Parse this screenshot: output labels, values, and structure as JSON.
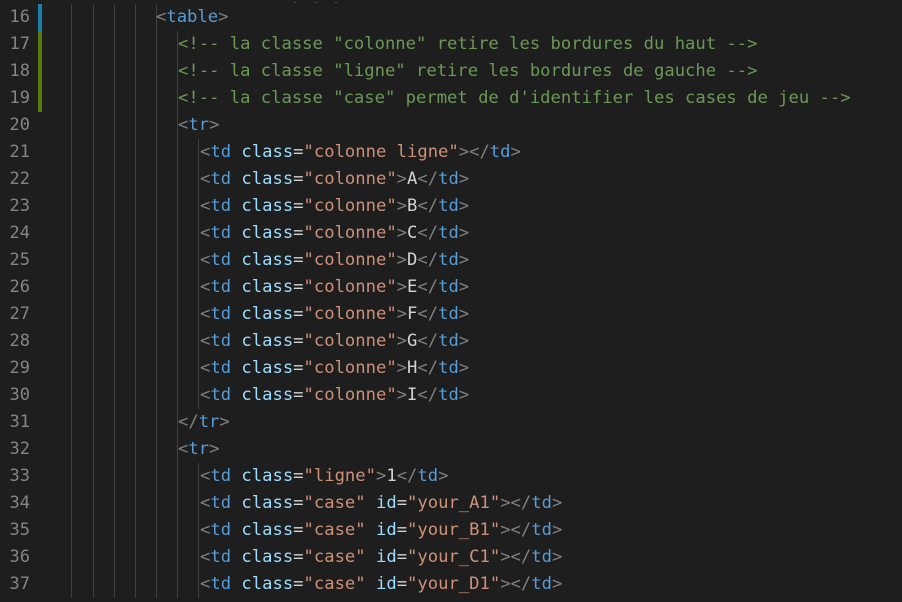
{
  "editor": {
    "theme": {
      "background": "#1e1e1e",
      "added_marker": "#587c0c",
      "modified_marker": "#1b81a8"
    },
    "lines": [
      {
        "n": "16",
        "marker": "modified",
        "tokens": [
          {
            "t": "punct",
            "v": "<"
          },
          {
            "t": "tag",
            "v": "table"
          },
          {
            "t": "punct",
            "v": ">"
          }
        ]
      },
      {
        "n": "17",
        "marker": "added",
        "tokens": [
          {
            "t": "comment",
            "v": "<!-- la classe \"colonne\" retire les bordures du haut -->"
          }
        ]
      },
      {
        "n": "18",
        "marker": "added",
        "tokens": [
          {
            "t": "comment",
            "v": "<!-- la classe \"ligne\" retire les bordures de gauche -->"
          }
        ]
      },
      {
        "n": "19",
        "marker": "added",
        "tokens": [
          {
            "t": "comment",
            "v": "<!-- la classe \"case\" permet de d'identifier les cases de jeu -->"
          }
        ]
      },
      {
        "n": "20",
        "marker": "",
        "tokens": [
          {
            "t": "punct",
            "v": "<"
          },
          {
            "t": "tag",
            "v": "tr"
          },
          {
            "t": "punct",
            "v": ">"
          }
        ]
      },
      {
        "n": "21",
        "marker": "",
        "tokens": [
          {
            "t": "punct",
            "v": "<"
          },
          {
            "t": "tag",
            "v": "td"
          },
          {
            "t": "text",
            "v": " "
          },
          {
            "t": "attr",
            "v": "class"
          },
          {
            "t": "text",
            "v": "="
          },
          {
            "t": "str",
            "v": "\"colonne ligne\""
          },
          {
            "t": "punct",
            "v": "></"
          },
          {
            "t": "tag",
            "v": "td"
          },
          {
            "t": "punct",
            "v": ">"
          }
        ]
      },
      {
        "n": "22",
        "marker": "",
        "tokens": [
          {
            "t": "punct",
            "v": "<"
          },
          {
            "t": "tag",
            "v": "td"
          },
          {
            "t": "text",
            "v": " "
          },
          {
            "t": "attr",
            "v": "class"
          },
          {
            "t": "text",
            "v": "="
          },
          {
            "t": "str",
            "v": "\"colonne\""
          },
          {
            "t": "punct",
            "v": ">"
          },
          {
            "t": "text",
            "v": "A"
          },
          {
            "t": "punct",
            "v": "</"
          },
          {
            "t": "tag",
            "v": "td"
          },
          {
            "t": "punct",
            "v": ">"
          }
        ]
      },
      {
        "n": "23",
        "marker": "",
        "tokens": [
          {
            "t": "punct",
            "v": "<"
          },
          {
            "t": "tag",
            "v": "td"
          },
          {
            "t": "text",
            "v": " "
          },
          {
            "t": "attr",
            "v": "class"
          },
          {
            "t": "text",
            "v": "="
          },
          {
            "t": "str",
            "v": "\"colonne\""
          },
          {
            "t": "punct",
            "v": ">"
          },
          {
            "t": "text",
            "v": "B"
          },
          {
            "t": "punct",
            "v": "</"
          },
          {
            "t": "tag",
            "v": "td"
          },
          {
            "t": "punct",
            "v": ">"
          }
        ]
      },
      {
        "n": "24",
        "marker": "",
        "tokens": [
          {
            "t": "punct",
            "v": "<"
          },
          {
            "t": "tag",
            "v": "td"
          },
          {
            "t": "text",
            "v": " "
          },
          {
            "t": "attr",
            "v": "class"
          },
          {
            "t": "text",
            "v": "="
          },
          {
            "t": "str",
            "v": "\"colonne\""
          },
          {
            "t": "punct",
            "v": ">"
          },
          {
            "t": "text",
            "v": "C"
          },
          {
            "t": "punct",
            "v": "</"
          },
          {
            "t": "tag",
            "v": "td"
          },
          {
            "t": "punct",
            "v": ">"
          }
        ]
      },
      {
        "n": "25",
        "marker": "",
        "tokens": [
          {
            "t": "punct",
            "v": "<"
          },
          {
            "t": "tag",
            "v": "td"
          },
          {
            "t": "text",
            "v": " "
          },
          {
            "t": "attr",
            "v": "class"
          },
          {
            "t": "text",
            "v": "="
          },
          {
            "t": "str",
            "v": "\"colonne\""
          },
          {
            "t": "punct",
            "v": ">"
          },
          {
            "t": "text",
            "v": "D"
          },
          {
            "t": "punct",
            "v": "</"
          },
          {
            "t": "tag",
            "v": "td"
          },
          {
            "t": "punct",
            "v": ">"
          }
        ]
      },
      {
        "n": "26",
        "marker": "",
        "tokens": [
          {
            "t": "punct",
            "v": "<"
          },
          {
            "t": "tag",
            "v": "td"
          },
          {
            "t": "text",
            "v": " "
          },
          {
            "t": "attr",
            "v": "class"
          },
          {
            "t": "text",
            "v": "="
          },
          {
            "t": "str",
            "v": "\"colonne\""
          },
          {
            "t": "punct",
            "v": ">"
          },
          {
            "t": "text",
            "v": "E"
          },
          {
            "t": "punct",
            "v": "</"
          },
          {
            "t": "tag",
            "v": "td"
          },
          {
            "t": "punct",
            "v": ">"
          }
        ]
      },
      {
        "n": "27",
        "marker": "",
        "tokens": [
          {
            "t": "punct",
            "v": "<"
          },
          {
            "t": "tag",
            "v": "td"
          },
          {
            "t": "text",
            "v": " "
          },
          {
            "t": "attr",
            "v": "class"
          },
          {
            "t": "text",
            "v": "="
          },
          {
            "t": "str",
            "v": "\"colonne\""
          },
          {
            "t": "punct",
            "v": ">"
          },
          {
            "t": "text",
            "v": "F"
          },
          {
            "t": "punct",
            "v": "</"
          },
          {
            "t": "tag",
            "v": "td"
          },
          {
            "t": "punct",
            "v": ">"
          }
        ]
      },
      {
        "n": "28",
        "marker": "",
        "tokens": [
          {
            "t": "punct",
            "v": "<"
          },
          {
            "t": "tag",
            "v": "td"
          },
          {
            "t": "text",
            "v": " "
          },
          {
            "t": "attr",
            "v": "class"
          },
          {
            "t": "text",
            "v": "="
          },
          {
            "t": "str",
            "v": "\"colonne\""
          },
          {
            "t": "punct",
            "v": ">"
          },
          {
            "t": "text",
            "v": "G"
          },
          {
            "t": "punct",
            "v": "</"
          },
          {
            "t": "tag",
            "v": "td"
          },
          {
            "t": "punct",
            "v": ">"
          }
        ]
      },
      {
        "n": "29",
        "marker": "",
        "tokens": [
          {
            "t": "punct",
            "v": "<"
          },
          {
            "t": "tag",
            "v": "td"
          },
          {
            "t": "text",
            "v": " "
          },
          {
            "t": "attr",
            "v": "class"
          },
          {
            "t": "text",
            "v": "="
          },
          {
            "t": "str",
            "v": "\"colonne\""
          },
          {
            "t": "punct",
            "v": ">"
          },
          {
            "t": "text",
            "v": "H"
          },
          {
            "t": "punct",
            "v": "</"
          },
          {
            "t": "tag",
            "v": "td"
          },
          {
            "t": "punct",
            "v": ">"
          }
        ]
      },
      {
        "n": "30",
        "marker": "",
        "tokens": [
          {
            "t": "punct",
            "v": "<"
          },
          {
            "t": "tag",
            "v": "td"
          },
          {
            "t": "text",
            "v": " "
          },
          {
            "t": "attr",
            "v": "class"
          },
          {
            "t": "text",
            "v": "="
          },
          {
            "t": "str",
            "v": "\"colonne\""
          },
          {
            "t": "punct",
            "v": ">"
          },
          {
            "t": "text",
            "v": "I"
          },
          {
            "t": "punct",
            "v": "</"
          },
          {
            "t": "tag",
            "v": "td"
          },
          {
            "t": "punct",
            "v": ">"
          }
        ]
      },
      {
        "n": "31",
        "marker": "",
        "tokens": [
          {
            "t": "punct",
            "v": "</"
          },
          {
            "t": "tag",
            "v": "tr"
          },
          {
            "t": "punct",
            "v": ">"
          }
        ]
      },
      {
        "n": "32",
        "marker": "",
        "tokens": [
          {
            "t": "punct",
            "v": "<"
          },
          {
            "t": "tag",
            "v": "tr"
          },
          {
            "t": "punct",
            "v": ">"
          }
        ]
      },
      {
        "n": "33",
        "marker": "",
        "tokens": [
          {
            "t": "punct",
            "v": "<"
          },
          {
            "t": "tag",
            "v": "td"
          },
          {
            "t": "text",
            "v": " "
          },
          {
            "t": "attr",
            "v": "class"
          },
          {
            "t": "text",
            "v": "="
          },
          {
            "t": "str",
            "v": "\"ligne\""
          },
          {
            "t": "punct",
            "v": ">"
          },
          {
            "t": "text",
            "v": "1"
          },
          {
            "t": "punct",
            "v": "</"
          },
          {
            "t": "tag",
            "v": "td"
          },
          {
            "t": "punct",
            "v": ">"
          }
        ]
      },
      {
        "n": "34",
        "marker": "",
        "tokens": [
          {
            "t": "punct",
            "v": "<"
          },
          {
            "t": "tag",
            "v": "td"
          },
          {
            "t": "text",
            "v": " "
          },
          {
            "t": "attr",
            "v": "class"
          },
          {
            "t": "text",
            "v": "="
          },
          {
            "t": "str",
            "v": "\"case\""
          },
          {
            "t": "text",
            "v": " "
          },
          {
            "t": "attr",
            "v": "id"
          },
          {
            "t": "text",
            "v": "="
          },
          {
            "t": "str",
            "v": "\"your_A1\""
          },
          {
            "t": "punct",
            "v": "></"
          },
          {
            "t": "tag",
            "v": "td"
          },
          {
            "t": "punct",
            "v": ">"
          }
        ]
      },
      {
        "n": "35",
        "marker": "",
        "tokens": [
          {
            "t": "punct",
            "v": "<"
          },
          {
            "t": "tag",
            "v": "td"
          },
          {
            "t": "text",
            "v": " "
          },
          {
            "t": "attr",
            "v": "class"
          },
          {
            "t": "text",
            "v": "="
          },
          {
            "t": "str",
            "v": "\"case\""
          },
          {
            "t": "text",
            "v": " "
          },
          {
            "t": "attr",
            "v": "id"
          },
          {
            "t": "text",
            "v": "="
          },
          {
            "t": "str",
            "v": "\"your_B1\""
          },
          {
            "t": "punct",
            "v": "></"
          },
          {
            "t": "tag",
            "v": "td"
          },
          {
            "t": "punct",
            "v": ">"
          }
        ]
      },
      {
        "n": "36",
        "marker": "",
        "tokens": [
          {
            "t": "punct",
            "v": "<"
          },
          {
            "t": "tag",
            "v": "td"
          },
          {
            "t": "text",
            "v": " "
          },
          {
            "t": "attr",
            "v": "class"
          },
          {
            "t": "text",
            "v": "="
          },
          {
            "t": "str",
            "v": "\"case\""
          },
          {
            "t": "text",
            "v": " "
          },
          {
            "t": "attr",
            "v": "id"
          },
          {
            "t": "text",
            "v": "="
          },
          {
            "t": "str",
            "v": "\"your_C1\""
          },
          {
            "t": "punct",
            "v": "></"
          },
          {
            "t": "tag",
            "v": "td"
          },
          {
            "t": "punct",
            "v": ">"
          }
        ]
      },
      {
        "n": "37",
        "marker": "",
        "tokens": [
          {
            "t": "punct",
            "v": "<"
          },
          {
            "t": "tag",
            "v": "td"
          },
          {
            "t": "text",
            "v": " "
          },
          {
            "t": "attr",
            "v": "class"
          },
          {
            "t": "text",
            "v": "="
          },
          {
            "t": "str",
            "v": "\"case\""
          },
          {
            "t": "text",
            "v": " "
          },
          {
            "t": "attr",
            "v": "id"
          },
          {
            "t": "text",
            "v": "="
          },
          {
            "t": "str",
            "v": "\"your_D1\""
          },
          {
            "t": "punct",
            "v": "></"
          },
          {
            "t": "tag",
            "v": "td"
          },
          {
            "t": "punct",
            "v": ">"
          }
        ]
      }
    ]
  }
}
